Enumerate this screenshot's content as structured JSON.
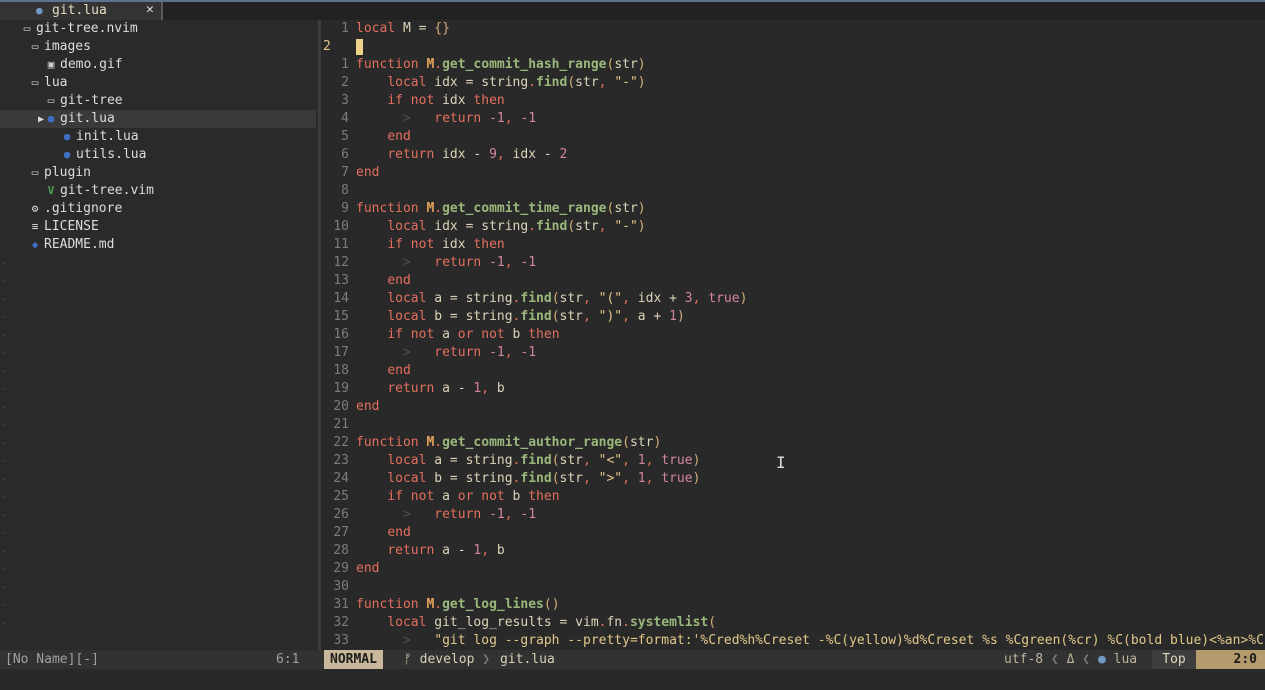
{
  "tab": {
    "title": "git.lua",
    "close": "✕"
  },
  "tree": {
    "items": [
      {
        "label": "git-tree.nvim"
      },
      {
        "label": "images"
      },
      {
        "label": "demo.gif"
      },
      {
        "label": "lua"
      },
      {
        "label": "git-tree"
      },
      {
        "label": "git.lua"
      },
      {
        "label": "init.lua"
      },
      {
        "label": "utils.lua"
      },
      {
        "label": "plugin"
      },
      {
        "label": "git-tree.vim"
      },
      {
        "label": ".gitignore"
      },
      {
        "label": "LICENSE"
      },
      {
        "label": "README.md"
      }
    ]
  },
  "editor": {
    "line_numbers": [
      "1",
      "2",
      "1",
      "2",
      "3",
      "4",
      "5",
      "6",
      "7",
      "8",
      "9",
      "10",
      "11",
      "12",
      "13",
      "14",
      "15",
      "16",
      "17",
      "18",
      "19",
      "20",
      "21",
      "22",
      "23",
      "24",
      "25",
      "26",
      "27",
      "28",
      "29",
      "30",
      "31",
      "32",
      "33"
    ],
    "lines": [
      "local M = {}",
      "",
      "function M.get_commit_hash_range(str)",
      "  local idx = string.find(str, \"-\")",
      "  if not idx then",
      "    return -1, -1",
      "  end",
      "  return idx - 9, idx - 2",
      "end",
      "",
      "function M.get_commit_time_range(str)",
      "  local idx = string.find(str, \"-\")",
      "  if not idx then",
      "    return -1, -1",
      "  end",
      "  local a = string.find(str, \"(\", idx + 3, true)",
      "  local b = string.find(str, \")\", a + 1)",
      "  if not a or not b then",
      "    return -1, -1",
      "  end",
      "  return a - 1, b",
      "end",
      "",
      "function M.get_commit_author_range(str)",
      "  local a = string.find(str, \"<\", 1, true)",
      "  local b = string.find(str, \">\", 1, true)",
      "  if not a or not b then",
      "    return -1, -1",
      "  end",
      "  return a - 1, b",
      "end",
      "",
      "function M.get_log_lines()",
      "  local git_log_results = vim.fn.systemlist(",
      "    \"git log --graph --pretty=format:'%Cred%h%Creset -%C(yellow)%d%Creset %s %Cgreen(%cr) %C(bold blue)<%an>%C"
    ]
  },
  "status": {
    "left_name": "[No Name][-]",
    "left_pos": "6:1",
    "mode": "NORMAL",
    "branch": "develop",
    "file": "git.lua",
    "encoding": "utf-8",
    "filetype": "lua",
    "scroll": "Top",
    "position": "2:0"
  },
  "colors": {
    "keyword": "#e36f5e",
    "function": "#9bb87c",
    "string": "#e3c78a",
    "number": "#d3869b",
    "mode_bg": "#c8b79a"
  },
  "icons": {
    "folder": "folder-open-icon",
    "lua": "lua-icon",
    "vim": "vim-icon",
    "gear": "gear-icon",
    "license": "license-icon",
    "markdown": "markdown-icon",
    "branch": "git-branch-icon",
    "linux": "linux-icon"
  }
}
